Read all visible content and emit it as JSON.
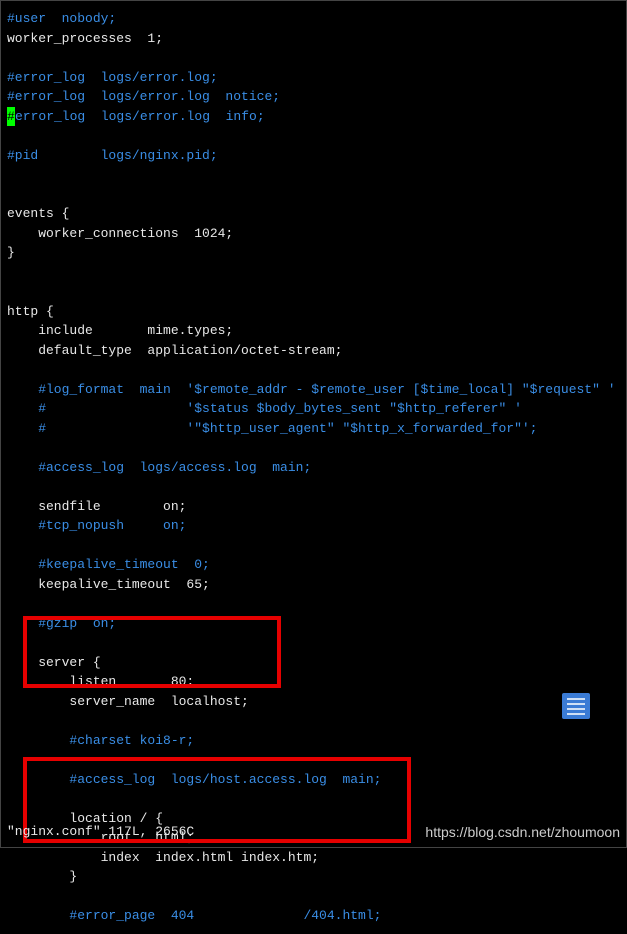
{
  "lines": [
    {
      "segments": [
        {
          "t": "#user  nobody;",
          "c": "c-blue"
        }
      ]
    },
    {
      "segments": [
        {
          "t": "worker_processes  1;",
          "c": "c-white"
        }
      ]
    },
    {
      "segments": [
        {
          "t": "",
          "c": "c-white"
        }
      ]
    },
    {
      "segments": [
        {
          "t": "#error_log  logs/error.log;",
          "c": "c-blue"
        }
      ]
    },
    {
      "segments": [
        {
          "t": "#error_log  logs/error.log  notice;",
          "c": "c-blue"
        }
      ]
    },
    {
      "segments": [
        {
          "t": "#",
          "c": "c-blue",
          "cursor": true
        },
        {
          "t": "error_log  logs/error.log  info;",
          "c": "c-blue"
        }
      ]
    },
    {
      "segments": [
        {
          "t": "",
          "c": "c-white"
        }
      ]
    },
    {
      "segments": [
        {
          "t": "#pid        logs/nginx.pid;",
          "c": "c-blue"
        }
      ]
    },
    {
      "segments": [
        {
          "t": "",
          "c": "c-white"
        }
      ]
    },
    {
      "segments": [
        {
          "t": "",
          "c": "c-white"
        }
      ]
    },
    {
      "segments": [
        {
          "t": "events {",
          "c": "c-white"
        }
      ]
    },
    {
      "segments": [
        {
          "t": "    worker_connections  1024;",
          "c": "c-white"
        }
      ]
    },
    {
      "segments": [
        {
          "t": "}",
          "c": "c-white"
        }
      ]
    },
    {
      "segments": [
        {
          "t": "",
          "c": "c-white"
        }
      ]
    },
    {
      "segments": [
        {
          "t": "",
          "c": "c-white"
        }
      ]
    },
    {
      "segments": [
        {
          "t": "http {",
          "c": "c-white"
        }
      ]
    },
    {
      "segments": [
        {
          "t": "    include       mime.types;",
          "c": "c-white"
        }
      ]
    },
    {
      "segments": [
        {
          "t": "    default_type  application/octet-stream;",
          "c": "c-white"
        }
      ]
    },
    {
      "segments": [
        {
          "t": "",
          "c": "c-white"
        }
      ]
    },
    {
      "segments": [
        {
          "t": "    #log_format  main  '$remote_addr - $remote_user [$time_local] \"$request\" '",
          "c": "c-blue"
        }
      ]
    },
    {
      "segments": [
        {
          "t": "    #                  '$status $body_bytes_sent \"$http_referer\" '",
          "c": "c-blue"
        }
      ]
    },
    {
      "segments": [
        {
          "t": "    #                  '\"$http_user_agent\" \"$http_x_forwarded_for\"';",
          "c": "c-blue"
        }
      ]
    },
    {
      "segments": [
        {
          "t": "",
          "c": "c-white"
        }
      ]
    },
    {
      "segments": [
        {
          "t": "    #access_log  logs/access.log  main;",
          "c": "c-blue"
        }
      ]
    },
    {
      "segments": [
        {
          "t": "",
          "c": "c-white"
        }
      ]
    },
    {
      "segments": [
        {
          "t": "    sendfile        on;",
          "c": "c-white"
        }
      ]
    },
    {
      "segments": [
        {
          "t": "    #tcp_nopush     on;",
          "c": "c-blue"
        }
      ]
    },
    {
      "segments": [
        {
          "t": "",
          "c": "c-white"
        }
      ]
    },
    {
      "segments": [
        {
          "t": "    #keepalive_timeout  0;",
          "c": "c-blue"
        }
      ]
    },
    {
      "segments": [
        {
          "t": "    keepalive_timeout  65;",
          "c": "c-white"
        }
      ]
    },
    {
      "segments": [
        {
          "t": "",
          "c": "c-white"
        }
      ]
    },
    {
      "segments": [
        {
          "t": "    #gzip  on;",
          "c": "c-blue"
        }
      ]
    },
    {
      "segments": [
        {
          "t": "",
          "c": "c-white"
        }
      ]
    },
    {
      "segments": [
        {
          "t": "    server {",
          "c": "c-white"
        }
      ]
    },
    {
      "segments": [
        {
          "t": "        listen       80;",
          "c": "c-white"
        }
      ]
    },
    {
      "segments": [
        {
          "t": "        server_name  localhost;",
          "c": "c-white"
        }
      ]
    },
    {
      "segments": [
        {
          "t": "",
          "c": "c-white"
        }
      ]
    },
    {
      "segments": [
        {
          "t": "        #charset koi8-r;",
          "c": "c-blue"
        }
      ]
    },
    {
      "segments": [
        {
          "t": "",
          "c": "c-white"
        }
      ]
    },
    {
      "segments": [
        {
          "t": "        #access_log  logs/host.access.log  main;",
          "c": "c-blue"
        }
      ]
    },
    {
      "segments": [
        {
          "t": "",
          "c": "c-white"
        }
      ]
    },
    {
      "segments": [
        {
          "t": "        location / {",
          "c": "c-white"
        }
      ]
    },
    {
      "segments": [
        {
          "t": "            root   html;",
          "c": "c-white"
        }
      ]
    },
    {
      "segments": [
        {
          "t": "            index  index.html index.htm;",
          "c": "c-white"
        }
      ]
    },
    {
      "segments": [
        {
          "t": "        }",
          "c": "c-white"
        }
      ]
    },
    {
      "segments": [
        {
          "t": "",
          "c": "c-white"
        }
      ]
    },
    {
      "segments": [
        {
          "t": "        #error_page  404              /404.html;",
          "c": "c-blue"
        }
      ]
    }
  ],
  "status": "\"nginx.conf\" 117L, 2656C",
  "watermark": "https://blog.csdn.net/zhoumoon"
}
